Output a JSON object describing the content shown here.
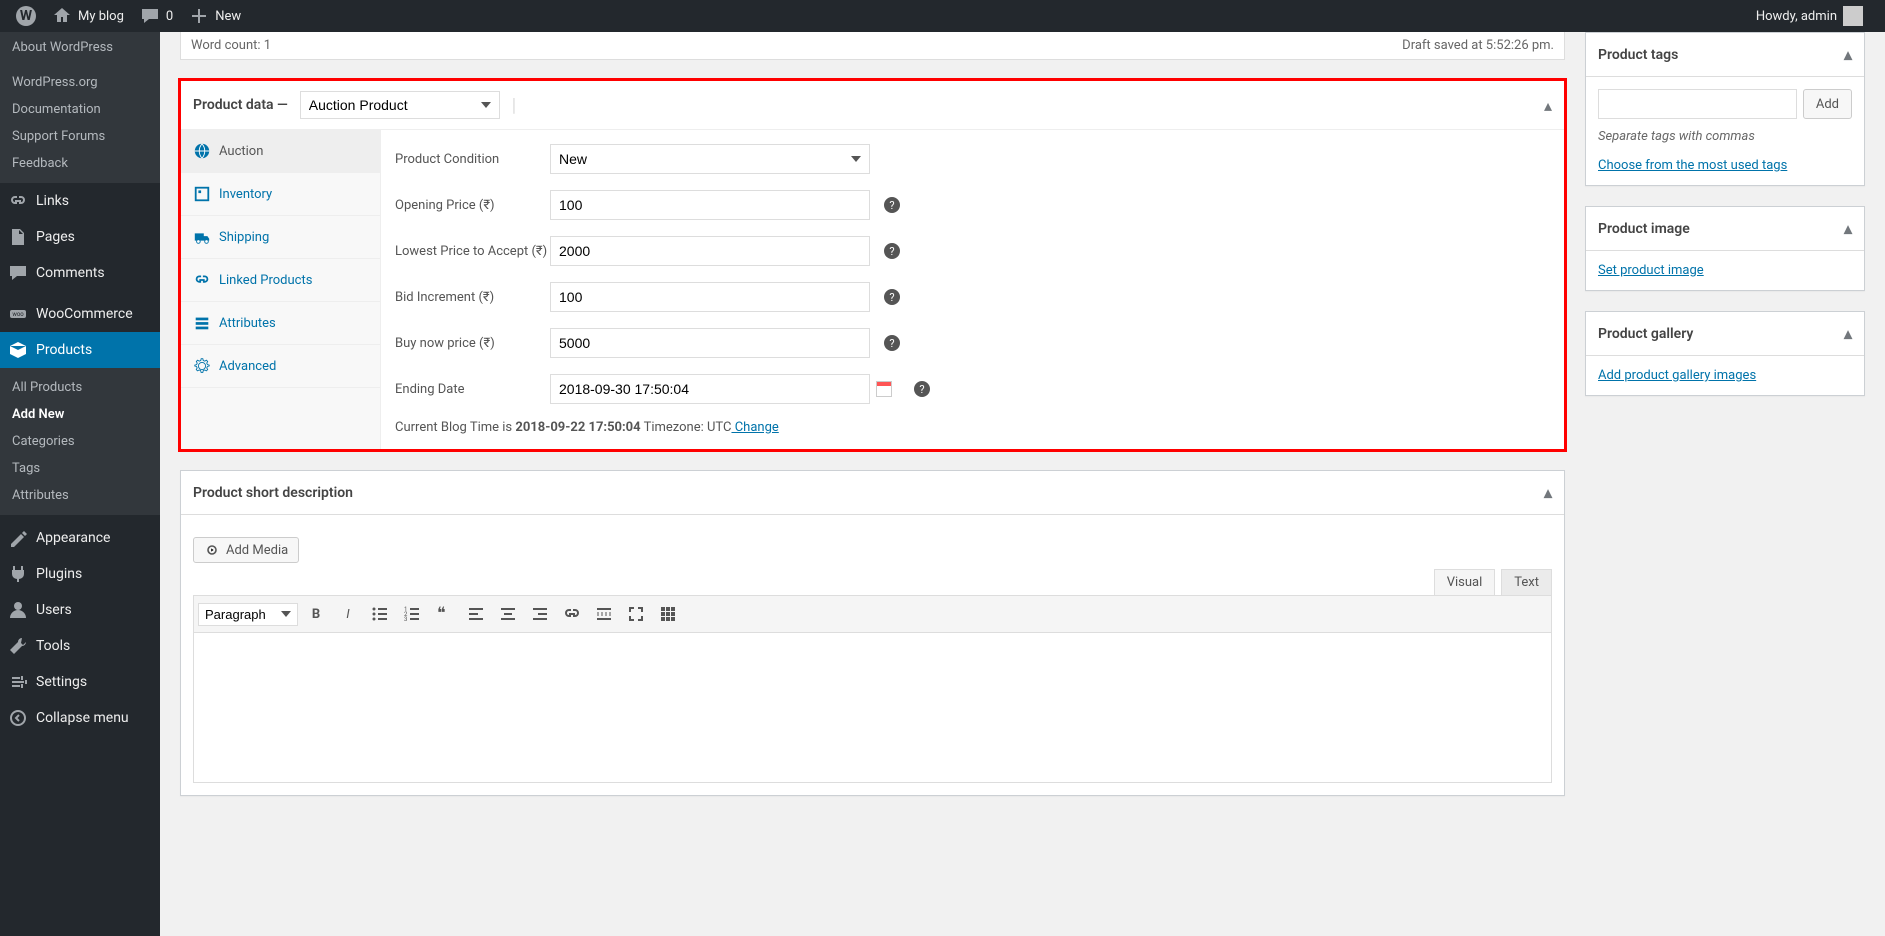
{
  "adminbar": {
    "site_name": "My blog",
    "comments_count": "0",
    "new_label": "New",
    "howdy": "Howdy, admin"
  },
  "sidebar": {
    "top_group": [
      {
        "label": "About WordPress"
      },
      {
        "label": "WordPress.org"
      },
      {
        "label": "Documentation"
      },
      {
        "label": "Support Forums"
      },
      {
        "label": "Feedback"
      }
    ],
    "items": [
      {
        "label": "Links"
      },
      {
        "label": "Pages"
      },
      {
        "label": "Comments"
      },
      {
        "label": "WooCommerce"
      },
      {
        "label": "Products"
      },
      {
        "label": "Appearance"
      },
      {
        "label": "Plugins"
      },
      {
        "label": "Users"
      },
      {
        "label": "Tools"
      },
      {
        "label": "Settings"
      },
      {
        "label": "Collapse menu"
      }
    ],
    "products_submenu": [
      {
        "label": "All Products"
      },
      {
        "label": "Add New"
      },
      {
        "label": "Categories"
      },
      {
        "label": "Tags"
      },
      {
        "label": "Attributes"
      }
    ]
  },
  "wordcount": {
    "label": "Word count: 1",
    "draft_saved": "Draft saved at 5:52:26 pm."
  },
  "product_data": {
    "title": "Product data —",
    "type_value": "Auction Product",
    "tabs": [
      {
        "label": "Auction"
      },
      {
        "label": "Inventory"
      },
      {
        "label": "Shipping"
      },
      {
        "label": "Linked Products"
      },
      {
        "label": "Attributes"
      },
      {
        "label": "Advanced"
      }
    ],
    "fields": {
      "condition_label": "Product Condition",
      "condition_value": "New",
      "opening_label": "Opening Price (₹)",
      "opening_value": "100",
      "lowest_label": "Lowest Price to Accept (₹)",
      "lowest_value": "2000",
      "bid_inc_label": "Bid Increment (₹)",
      "bid_inc_value": "100",
      "buy_now_label": "Buy now price (₹)",
      "buy_now_value": "5000",
      "ending_label": "Ending Date",
      "ending_value": "2018-09-30 17:50:04"
    },
    "footnote_prefix": "Current Blog Time is ",
    "footnote_time": "2018-09-22 17:50:04",
    "footnote_tz": " Timezone: UTC",
    "footnote_change": " Change"
  },
  "short_desc": {
    "title": "Product short description",
    "add_media": "Add Media",
    "tab_visual": "Visual",
    "tab_text": "Text",
    "paragraph_option": "Paragraph"
  },
  "tags_box": {
    "title": "Product tags",
    "add_btn": "Add",
    "hint": "Separate tags with commas",
    "choose_link": "Choose from the most used tags"
  },
  "image_box": {
    "title": "Product image",
    "set_link": "Set product image"
  },
  "gallery_box": {
    "title": "Product gallery",
    "add_link": "Add product gallery images"
  }
}
